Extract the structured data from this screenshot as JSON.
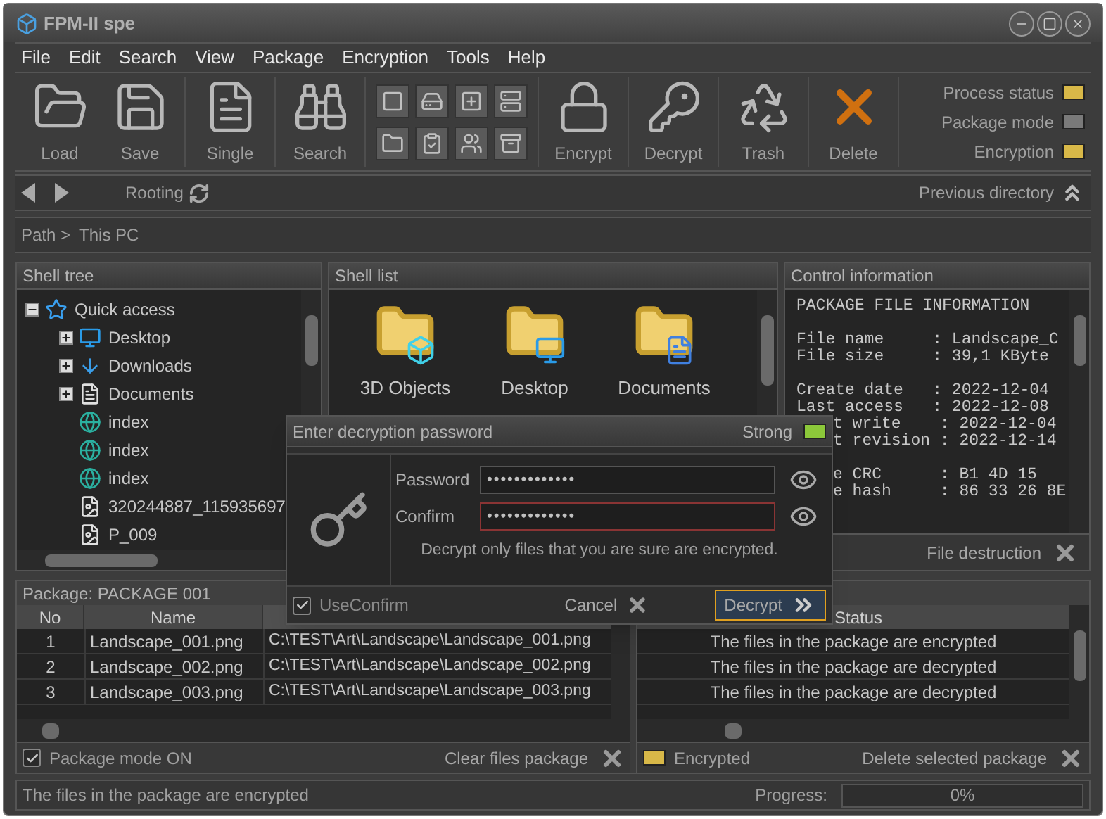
{
  "window": {
    "title": "FPM-II spe"
  },
  "menu": [
    "File",
    "Edit",
    "Search",
    "View",
    "Package",
    "Encryption",
    "Tools",
    "Help"
  ],
  "toolbar": {
    "buttons": [
      {
        "label": "Load"
      },
      {
        "label": "Save"
      },
      {
        "label": "Single"
      },
      {
        "label": "Search"
      },
      {
        "label": "Encrypt"
      },
      {
        "label": "Decrypt"
      },
      {
        "label": "Trash"
      },
      {
        "label": "Delete"
      }
    ],
    "indicators": [
      {
        "label": "Process status",
        "on": true
      },
      {
        "label": "Package mode",
        "on": false
      },
      {
        "label": "Encryption",
        "on": true
      }
    ]
  },
  "navigation": {
    "rooting": "Rooting",
    "previous_directory": "Previous directory"
  },
  "path": {
    "label": "Path >",
    "location": "This PC"
  },
  "shell_tree": {
    "title": "Shell tree",
    "items": [
      {
        "label": "Quick access",
        "kind": "star",
        "expanded": true,
        "children": [
          {
            "label": "Desktop",
            "kind": "desktop",
            "expanded": false
          },
          {
            "label": "Downloads",
            "kind": "downloads",
            "expanded": false
          },
          {
            "label": "Documents",
            "kind": "documents",
            "expanded": false
          },
          {
            "label": "index",
            "kind": "web"
          },
          {
            "label": "index",
            "kind": "web"
          },
          {
            "label": "index",
            "kind": "web"
          },
          {
            "label": "320244887_115935697",
            "kind": "image"
          },
          {
            "label": "P_009",
            "kind": "image"
          }
        ]
      }
    ]
  },
  "shell_list": {
    "title": "Shell list",
    "items": [
      {
        "label": "3D Objects",
        "kind": "objects"
      },
      {
        "label": "Desktop",
        "kind": "desktop"
      },
      {
        "label": "Documents",
        "kind": "documents"
      }
    ]
  },
  "control_information": {
    "title": "Control information",
    "blocks": [
      [
        {
          "text": "PACKAGE FILE INFORMATION",
          "kind": "full"
        }
      ],
      [
        {
          "text": "File name     : Landscape_C",
          "kind": "full"
        },
        {
          "text": "File size     : 39,1 KByte",
          "kind": "full"
        }
      ],
      [
        {
          "text": "Create date   : 2022-12-04",
          "kind": "full"
        },
        {
          "text": "Last access   : 2022-12-08",
          "kind": "full"
        },
        {
          "text": "t write    : 2022-12-04",
          "kind": "covered"
        },
        {
          "text": "t revision : 2022-12-14",
          "kind": "covered"
        }
      ],
      [
        {
          "text": "e CRC      : B1 4D 15",
          "kind": "covered"
        },
        {
          "text": "e hash     : 86 33 26 8E",
          "kind": "covered"
        }
      ]
    ],
    "file_destruction": "File destruction"
  },
  "package": {
    "title": "Package: PACKAGE 001",
    "columns": [
      "No",
      "Name"
    ],
    "rows": [
      {
        "no": "1",
        "name": "Landscape_001.png",
        "path": "C:\\TEST\\Art\\Landscape\\Landscape_001.png"
      },
      {
        "no": "2",
        "name": "Landscape_002.png",
        "path": "C:\\TEST\\Art\\Landscape\\Landscape_002.png"
      },
      {
        "no": "3",
        "name": "Landscape_003.png",
        "path": "C:\\TEST\\Art\\Landscape\\Landscape_003.png"
      }
    ],
    "package_mode": {
      "label": "Package mode ON",
      "checked": true
    },
    "clear": "Clear files package"
  },
  "status_table": {
    "column": "Status",
    "rows": [
      "The files in the package are encrypted",
      "The files in the package are decrypted",
      "The files in the package are decrypted"
    ],
    "encrypted": {
      "label": "Encrypted",
      "on": true
    },
    "delete": "Delete selected package"
  },
  "status_bar": {
    "message": "The files in the package are encrypted",
    "progress_label": "Progress:",
    "progress": "0%",
    "level": 0
  },
  "dialog": {
    "title": "Enter decryption password",
    "strength": {
      "label": "Strong",
      "on": true
    },
    "fields": [
      {
        "label": "Password",
        "value": "•••••••••••••",
        "focused": false
      },
      {
        "label": "Confirm",
        "value": "•••••••••••••",
        "focused": true
      }
    ],
    "hint": "Decrypt only files that you are sure are encrypted.",
    "use_confirm": {
      "label": "UseConfirm",
      "checked": true
    },
    "buttons": [
      {
        "label": "Cancel",
        "kind": "cancel",
        "selected": false
      },
      {
        "label": "Decrypt",
        "kind": "confirm",
        "selected": true
      }
    ]
  }
}
